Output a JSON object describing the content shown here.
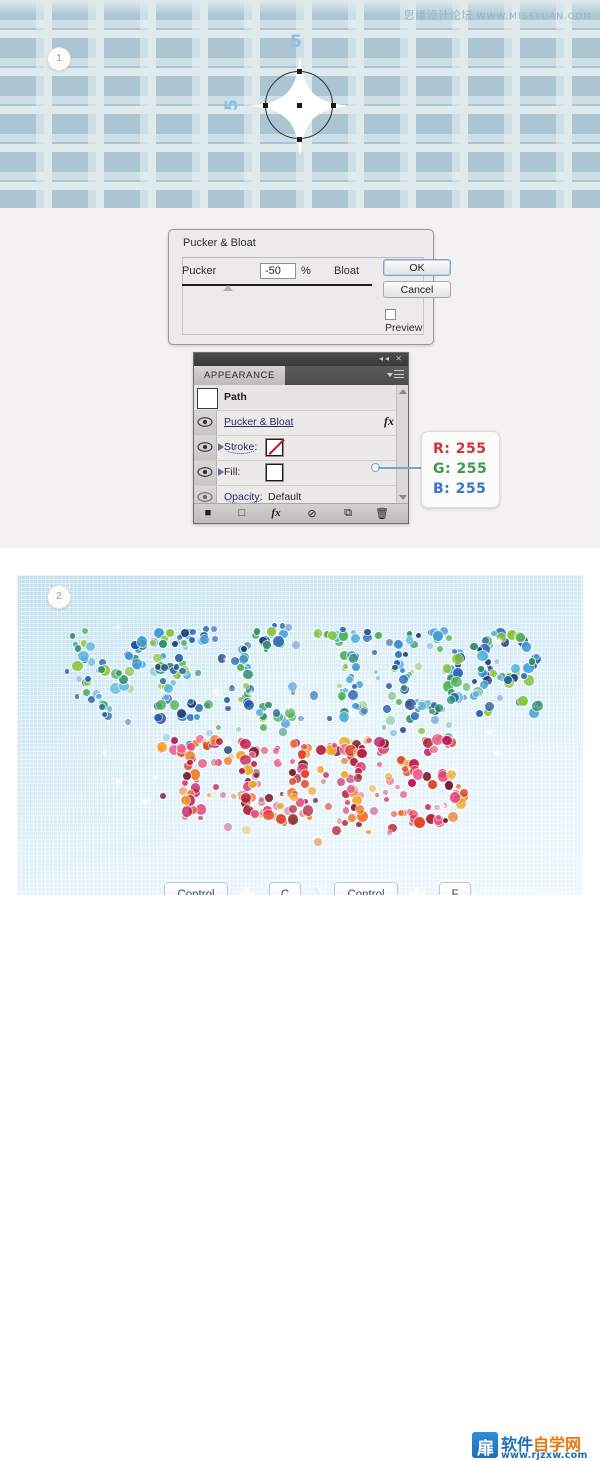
{
  "watermark": {
    "site": "思缘设计论坛",
    "url": "WWW.MISSYUAN.COM"
  },
  "step1": {
    "badge": "1",
    "label_top": "5",
    "label_left": "5",
    "shape": "circle-with-pucker-star"
  },
  "dialog": {
    "title": "Pucker & Bloat",
    "pucker_label": "Pucker",
    "bloat_label": "Bloat",
    "percent_symbol": "%",
    "value": "-50",
    "ok_label": "OK",
    "cancel_label": "Cancel",
    "preview_label": "Preview",
    "preview_checked": false
  },
  "panel": {
    "tab_label": "APPEARANCE",
    "collapse_icon": "◂◂",
    "close_icon": "✕",
    "rows": [
      {
        "name": "path",
        "label": "Path",
        "swatch": "white",
        "bold": true
      },
      {
        "name": "pucker-bloat",
        "label": "Pucker & Bloat",
        "fx": "fx"
      },
      {
        "name": "stroke",
        "label": "Stroke:",
        "swatch": "none"
      },
      {
        "name": "fill",
        "label": "Fill:",
        "swatch": "white"
      },
      {
        "name": "opacity",
        "label": "Opacity:",
        "value": "Default"
      }
    ],
    "footer_icons": [
      "new-art-has-basic-appearance-icon",
      "add-new-fill-icon",
      "add-new-effect-icon",
      "clear-appearance-icon",
      "duplicate-item-icon",
      "delete-item-icon"
    ]
  },
  "callout": {
    "r": "R: 255",
    "g": "G: 255",
    "b": "B: 255",
    "color_r": "#d0333a",
    "color_g": "#3c9a4b",
    "color_b": "#3b76c4"
  },
  "step2": {
    "badge": "2",
    "artwork_text_top": "VECTOR",
    "artwork_text_bottom": "TUTS",
    "artwork_palette_top": [
      "#1b3f7a",
      "#2b6bb5",
      "#3f9ad6",
      "#58b6e0",
      "#2f8f6b",
      "#52b35a",
      "#8cc63f",
      "#1f5aa0"
    ],
    "artwork_palette_bottom": [
      "#b5243a",
      "#e0482f",
      "#f27a2a",
      "#f5a623",
      "#e8467c",
      "#c2185b",
      "#f06292",
      "#7b1d2b"
    ]
  },
  "shortcuts": {
    "items": [
      {
        "type": "key",
        "label": "Control"
      },
      {
        "type": "plus",
        "label": "+"
      },
      {
        "type": "key",
        "label": "C"
      },
      {
        "type": "chevron",
        "label": "❯"
      },
      {
        "type": "key",
        "label": "Control"
      },
      {
        "type": "plus",
        "label": "+"
      },
      {
        "type": "key",
        "label": "F"
      }
    ]
  },
  "logo": {
    "mark": "扉",
    "name_blue": "软件",
    "name_orange": "自学网",
    "url": "www.rjzxw.com"
  }
}
